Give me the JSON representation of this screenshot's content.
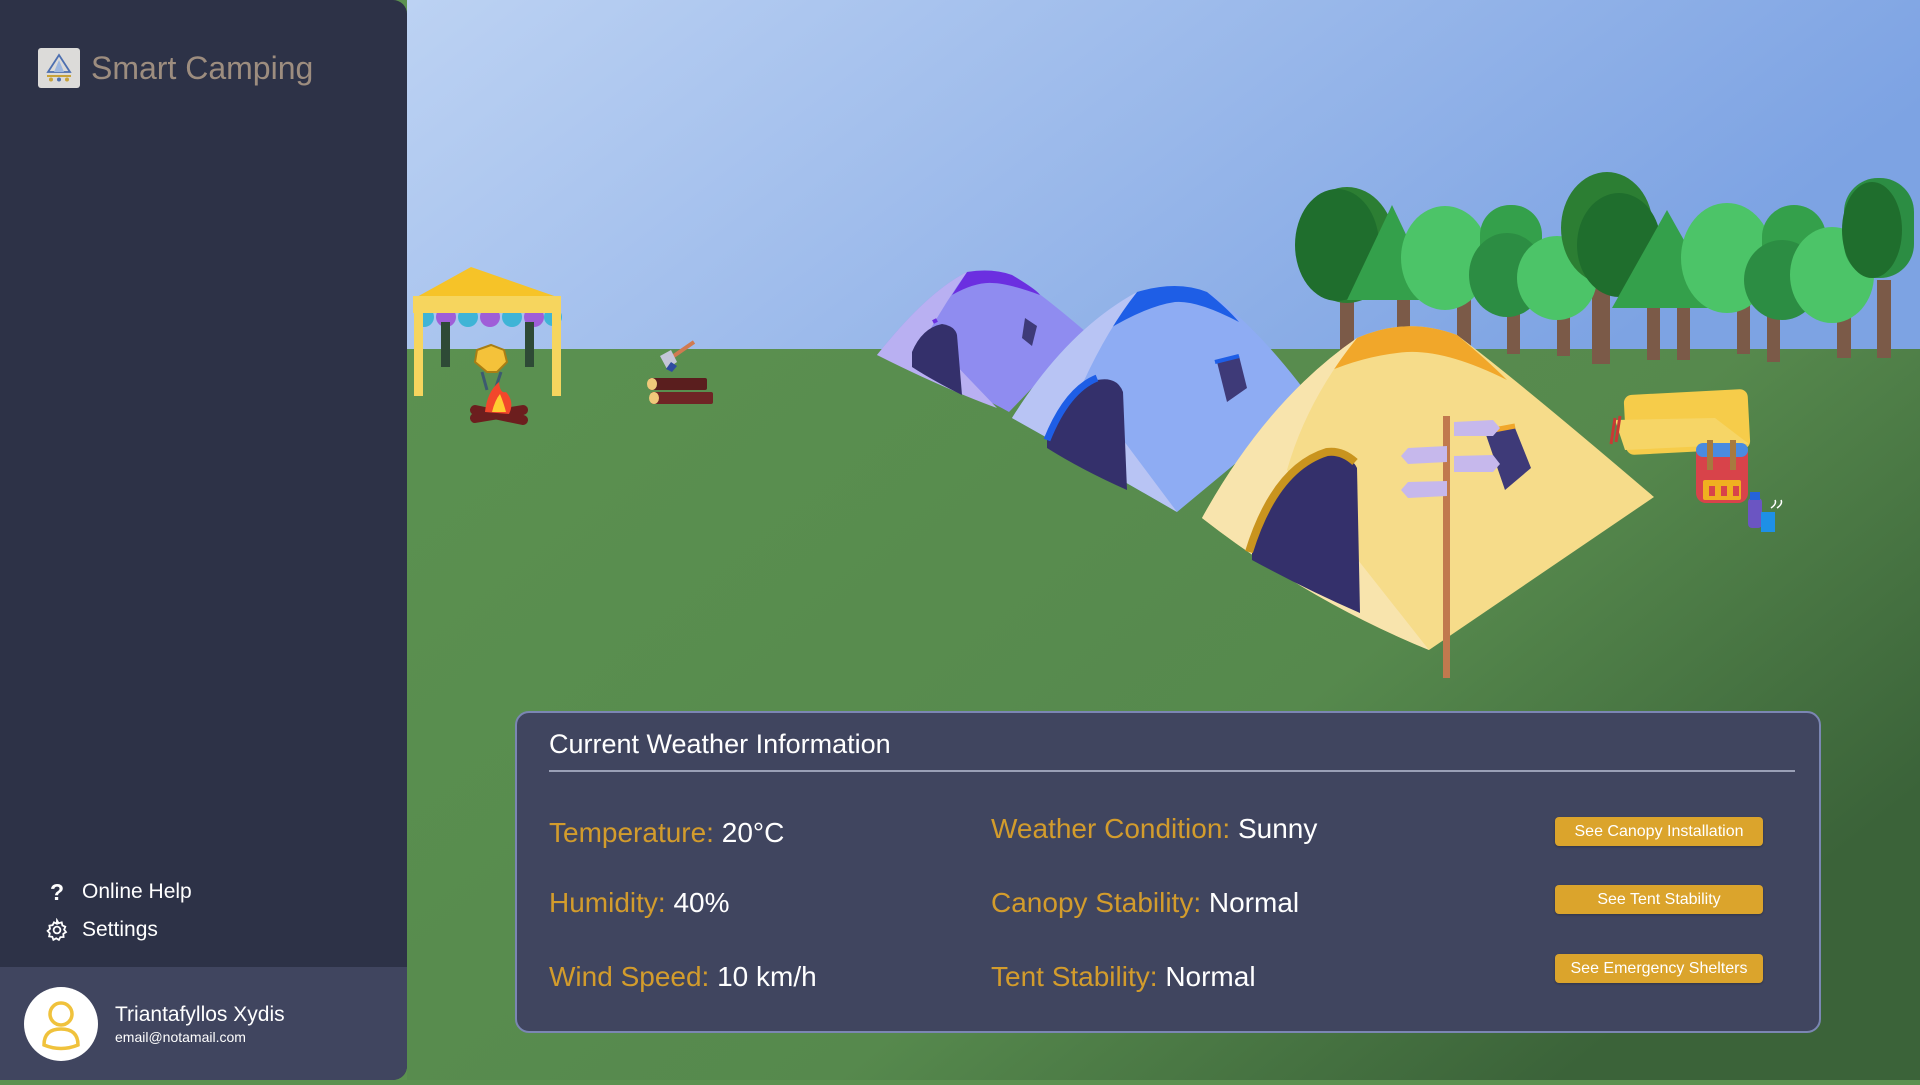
{
  "app": {
    "title": "Smart Camping"
  },
  "sidebar": {
    "menu": [
      {
        "label": "Online Help",
        "icon": "question-icon"
      },
      {
        "label": "Settings",
        "icon": "gear-icon"
      }
    ],
    "user": {
      "name": "Triantafyllos Xydis",
      "email": "email@notamail.com"
    }
  },
  "weather": {
    "title": "Current Weather Information",
    "stats": [
      {
        "label": "Temperature:",
        "value": "20°C"
      },
      {
        "label": "Humidity:",
        "value": "40%"
      },
      {
        "label": "Wind Speed:",
        "value": "10 km/h"
      },
      {
        "label": "Weather Condition:",
        "value": "Sunny"
      },
      {
        "label": "Canopy Stability:",
        "value": "Normal"
      },
      {
        "label": "Tent Stability:",
        "value": "Normal"
      }
    ],
    "buttons": [
      {
        "label": "See Canopy Installation"
      },
      {
        "label": "See Tent Stability"
      },
      {
        "label": "See Emergency Shelters"
      }
    ]
  },
  "colors": {
    "sidebar": "#2d3247",
    "card": "#40455f",
    "accent": "#d39c2c",
    "button": "#dba42c",
    "brand_text": "#9d8d7f"
  }
}
